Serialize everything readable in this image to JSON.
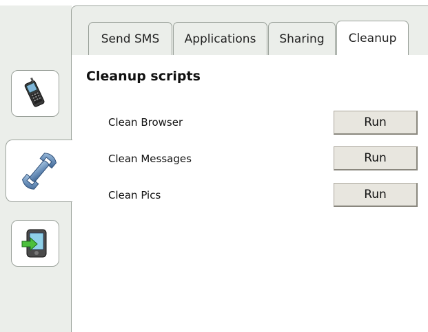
{
  "tabs": [
    "Send SMS",
    "Applications",
    "Sharing",
    "Cleanup"
  ],
  "active_tab": "Cleanup",
  "side_tabs": [
    {
      "icon": "mobile-phone-icon"
    },
    {
      "icon": "wrench-icon",
      "active": true
    },
    {
      "icon": "pda-sync-icon"
    }
  ],
  "section_title": "Cleanup scripts",
  "scripts": [
    {
      "label": "Clean Browser",
      "button": "Run"
    },
    {
      "label": "Clean Messages",
      "button": "Run"
    },
    {
      "label": "Clean Pics",
      "button": "Run"
    }
  ],
  "colors": {
    "panel_bg": "#ebeeea",
    "border": "#9aa19a",
    "button_bg": "#e8e6df"
  }
}
